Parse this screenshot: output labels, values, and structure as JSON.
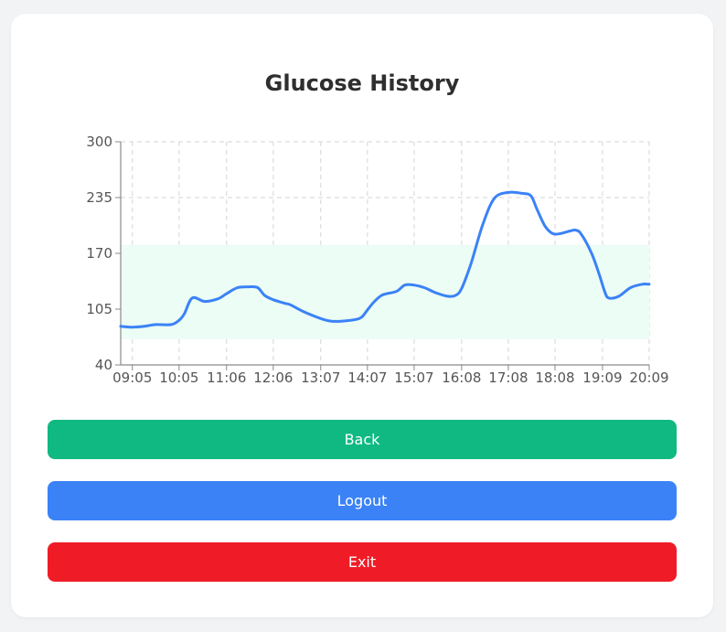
{
  "page": {
    "title": "Glucose History"
  },
  "buttons": {
    "back": {
      "label": "Back",
      "color": "#10b981"
    },
    "logout": {
      "label": "Logout",
      "color": "#3b82f6"
    },
    "exit": {
      "label": "Exit",
      "color": "#ef1c27"
    }
  },
  "chart_data": {
    "type": "line",
    "title": "Glucose History",
    "xlabel": "",
    "ylabel": "",
    "x_tick_labels": [
      "09:05",
      "10:05",
      "11:06",
      "12:06",
      "13:07",
      "14:07",
      "15:07",
      "16:08",
      "17:08",
      "18:08",
      "19:09",
      "20:09"
    ],
    "y_ticks": [
      40,
      105,
      170,
      235,
      300
    ],
    "ylim": [
      40,
      300
    ],
    "grid": true,
    "target_range": {
      "low": 70,
      "high": 180,
      "color": "#ecfdf5"
    },
    "line_color": "#3b82f6",
    "x_start": "08:50",
    "x_end": "20:09",
    "series": [
      {
        "points": [
          [
            "08:50",
            85
          ],
          [
            "09:05",
            84
          ],
          [
            "09:20",
            85
          ],
          [
            "09:35",
            87
          ],
          [
            "09:55",
            87
          ],
          [
            "10:05",
            92
          ],
          [
            "10:12",
            100
          ],
          [
            "10:22",
            118
          ],
          [
            "10:38",
            114
          ],
          [
            "10:55",
            117
          ],
          [
            "11:06",
            123
          ],
          [
            "11:20",
            130
          ],
          [
            "11:35",
            131
          ],
          [
            "11:46",
            130
          ],
          [
            "11:55",
            121
          ],
          [
            "12:06",
            116
          ],
          [
            "12:20",
            112
          ],
          [
            "12:28",
            110
          ],
          [
            "12:45",
            102
          ],
          [
            "13:07",
            94
          ],
          [
            "13:20",
            91
          ],
          [
            "13:35",
            91
          ],
          [
            "13:52",
            93
          ],
          [
            "14:00",
            96
          ],
          [
            "14:07",
            104
          ],
          [
            "14:15",
            113
          ],
          [
            "14:25",
            121
          ],
          [
            "14:32",
            123
          ],
          [
            "14:45",
            126
          ],
          [
            "14:55",
            133
          ],
          [
            "15:07",
            133
          ],
          [
            "15:20",
            130
          ],
          [
            "15:35",
            124
          ],
          [
            "15:50",
            120
          ],
          [
            "16:00",
            121
          ],
          [
            "16:08",
            129
          ],
          [
            "16:20",
            158
          ],
          [
            "16:35",
            203
          ],
          [
            "16:50",
            234
          ],
          [
            "17:08",
            241
          ],
          [
            "17:25",
            240
          ],
          [
            "17:37",
            237
          ],
          [
            "17:45",
            221
          ],
          [
            "17:55",
            202
          ],
          [
            "18:05",
            193
          ],
          [
            "18:15",
            193
          ],
          [
            "18:27",
            196
          ],
          [
            "18:35",
            197
          ],
          [
            "18:42",
            192
          ],
          [
            "18:55",
            170
          ],
          [
            "19:05",
            145
          ],
          [
            "19:12",
            125
          ],
          [
            "19:17",
            118
          ],
          [
            "19:30",
            120
          ],
          [
            "19:45",
            130
          ],
          [
            "20:00",
            134
          ],
          [
            "20:09",
            134
          ]
        ]
      }
    ]
  }
}
